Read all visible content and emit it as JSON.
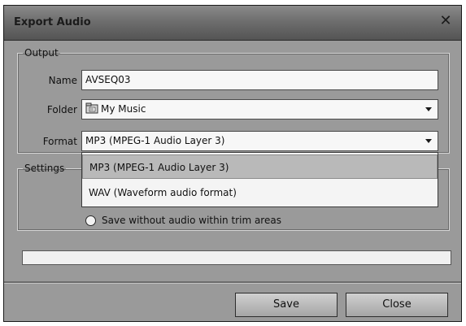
{
  "window": {
    "title": "Export Audio",
    "close_glyph": "✕"
  },
  "output": {
    "legend": "Output",
    "name_label": "Name",
    "name_value": "AVSEQ03",
    "folder_label": "Folder",
    "folder_value": "My Music",
    "folder_icon": "folder-icon",
    "format_label": "Format",
    "format_value": "MP3 (MPEG-1 Audio Layer 3)"
  },
  "format_dropdown": {
    "options": [
      {
        "label": "MP3 (MPEG-1 Audio Layer 3)",
        "selected": true
      },
      {
        "label": "WAV (Waveform audio format)",
        "selected": false
      }
    ]
  },
  "settings": {
    "legend": "Settings",
    "radio_label": "Save without audio within trim areas",
    "radio_checked": false
  },
  "progress": {
    "value": 0.0
  },
  "buttons": {
    "save_label": "Save",
    "close_label": "Close"
  }
}
